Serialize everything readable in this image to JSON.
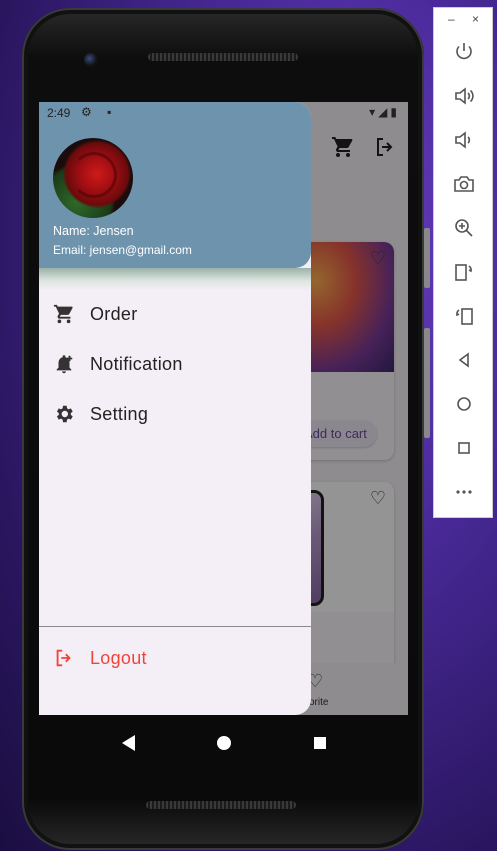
{
  "status_bar": {
    "time": "2:49"
  },
  "drawer": {
    "user": {
      "name": "Name: Jensen",
      "email": "Email: jensen@gmail.com"
    },
    "menu": [
      {
        "label": "Order",
        "icon": "cart-icon"
      },
      {
        "label": "Notification",
        "icon": "bell-add-icon"
      },
      {
        "label": "Setting",
        "icon": "gear-icon"
      }
    ],
    "logout": {
      "label": "Logout",
      "icon": "logout-icon",
      "color": "#f04438"
    }
  },
  "background_app": {
    "products": [
      {
        "title": "ro",
        "button": "Add to cart"
      },
      {
        "title": "ro"
      }
    ],
    "bottom_nav": {
      "favorite_label": "orite"
    }
  },
  "emulator_panel": {
    "window_controls": {
      "minimize": "–",
      "close": "×"
    },
    "buttons": [
      "power-icon",
      "volume-up-icon",
      "volume-down-icon",
      "camera-icon",
      "zoom-icon",
      "rotate-left-icon",
      "rotate-right-icon",
      "back-icon",
      "home-icon",
      "overview-icon",
      "more-icon"
    ]
  },
  "colors": {
    "drawer_header": "#6d93ad",
    "logout": "#f04438",
    "drawer_bg": "#f4eef6"
  }
}
